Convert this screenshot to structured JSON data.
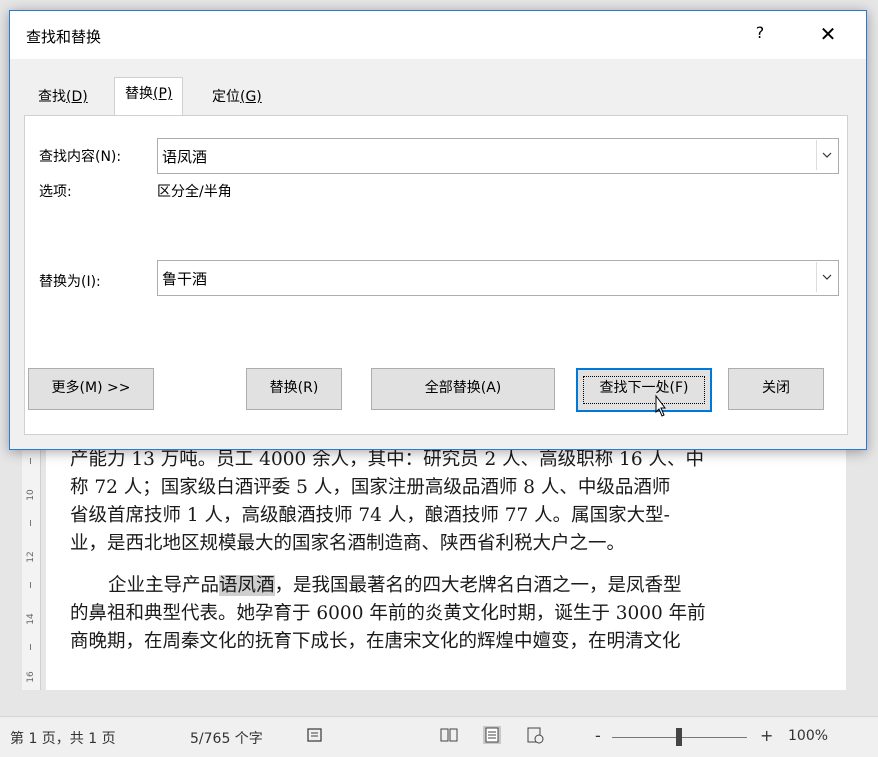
{
  "document": {
    "lines": [
      "产能力 13 万吨。员工 4000 余人，其中：研究员 2 人、高级职称 16 人、中",
      "称 72 人；国家级白酒评委 5 人，国家注册高级品酒师 8 人、中级品酒师",
      "省级首席技师 1 人，高级酿酒技师 74 人，酿酒技师 77 人。属国家大型-",
      "业，是西北地区规模最大的国家名酒制造商、陕西省利税大户之一。"
    ],
    "para2_prefix": "企业主导产品",
    "para2_highlight": "语凤酒",
    "para2_rest": "，是我国最著名的四大老牌名白酒之一，是凤香型",
    "para2_lines": [
      "的鼻祖和典型代表。她孕育于 6000 年前的炎黄文化时期，诞生于 3000 年前",
      "商晚期，在周秦文化的抚育下成长，在唐宋文化的辉煌中嬗变，在明清文化"
    ],
    "ruler_marks": [
      "10",
      "12",
      "14",
      "16"
    ]
  },
  "status_bar": {
    "page": "第 1 页，共 1 页",
    "words": "5/765 个字",
    "zoom": "100%",
    "zoom_minus": "-",
    "zoom_plus": "+"
  },
  "dialog": {
    "title": "查找和替换",
    "help": "?",
    "close": "✕",
    "tabs": [
      {
        "label": "查找",
        "key": "(D)"
      },
      {
        "label": "替换",
        "key": "(P)"
      },
      {
        "label": "定位",
        "key": "(G)"
      }
    ],
    "find_label": "查找内容(N):",
    "find_value": "语凤酒",
    "options_label": "选项:",
    "options_value": "区分全/半角",
    "replace_label": "替换为(I):",
    "replace_value": "鲁干酒",
    "buttons": {
      "more": "更多(M) >>",
      "replace": "替换(R)",
      "replace_all": "全部替换(A)",
      "find_next": "查找下一处(F)",
      "close": "关闭"
    }
  }
}
